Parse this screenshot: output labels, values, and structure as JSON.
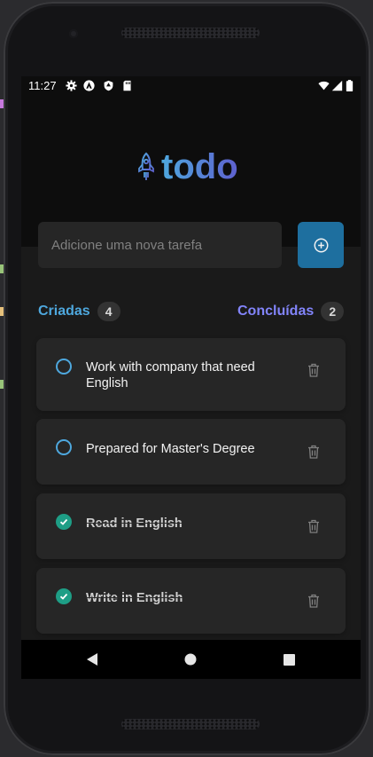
{
  "status_bar": {
    "time": "11:27",
    "icons": [
      "settings-icon",
      "accessibility-icon",
      "shield-icon",
      "sd-card-icon",
      "wifi-icon",
      "signal-icon",
      "battery-icon"
    ]
  },
  "header": {
    "logo_text": "todo",
    "logo_icon": "rocket-icon"
  },
  "new_task": {
    "placeholder": "Adicione uma nova tarefa",
    "add_icon": "plus-circle-icon"
  },
  "counters": {
    "created_label": "Criadas",
    "created_count": "4",
    "done_label": "Concluídas",
    "done_count": "2"
  },
  "tasks": [
    {
      "text": "Work with company that need English",
      "done": false
    },
    {
      "text": "Prepared for Master's Degree",
      "done": false
    },
    {
      "text": "Read in English",
      "done": true
    },
    {
      "text": "Write in English",
      "done": true
    }
  ],
  "colors": {
    "blue": "#4ea8de",
    "purple": "#5e60ce",
    "button": "#1e6f9f",
    "check_done": "#1e9e86"
  },
  "navigation": [
    "back-icon",
    "home-icon",
    "recents-icon"
  ]
}
